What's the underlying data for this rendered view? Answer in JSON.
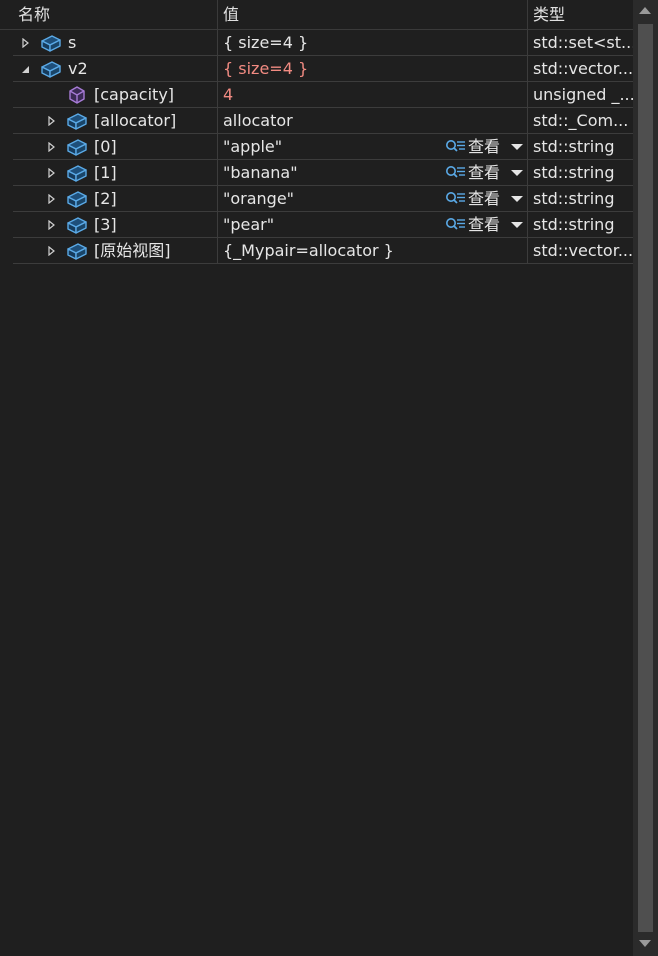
{
  "columns": {
    "name": "名称",
    "value": "值",
    "type": "类型"
  },
  "colors": {
    "background": "#1f1f1f",
    "changed_value": "#f28b82",
    "object_icon": "#4a9fd8",
    "property_icon": "#a77bd6"
  },
  "rows": [
    {
      "name": "s",
      "value": "{ size=4 }",
      "type": "std::set<st...",
      "expander": "collapsed",
      "icon": "object-icon",
      "changed": false,
      "viewer": ""
    },
    {
      "name": "v2",
      "value": "{ size=4 }",
      "type": "std::vector...",
      "expander": "expanded",
      "icon": "object-icon",
      "changed": true,
      "viewer": ""
    },
    {
      "name": "[capacity]",
      "value": "4",
      "type": "unsigned _...",
      "expander": "none",
      "icon": "property-icon",
      "changed": true,
      "viewer": ""
    },
    {
      "name": "[allocator]",
      "value": "allocator",
      "type": "std::_Com...",
      "expander": "collapsed",
      "icon": "object-icon",
      "changed": false,
      "viewer": ""
    },
    {
      "name": "[0]",
      "value": "\"apple\"",
      "type": "std::string",
      "expander": "collapsed",
      "icon": "object-icon",
      "changed": false,
      "viewer": "查看"
    },
    {
      "name": "[1]",
      "value": "\"banana\"",
      "type": "std::string",
      "expander": "collapsed",
      "icon": "object-icon",
      "changed": false,
      "viewer": "查看"
    },
    {
      "name": "[2]",
      "value": "\"orange\"",
      "type": "std::string",
      "expander": "collapsed",
      "icon": "object-icon",
      "changed": false,
      "viewer": "查看"
    },
    {
      "name": "[3]",
      "value": "\"pear\"",
      "type": "std::string",
      "expander": "collapsed",
      "icon": "object-icon",
      "changed": false,
      "viewer": "查看"
    },
    {
      "name": "[原始视图]",
      "value": "{_Mypair=allocator }",
      "type": "std::vector...",
      "expander": "collapsed",
      "icon": "object-icon",
      "changed": false,
      "viewer": ""
    }
  ]
}
